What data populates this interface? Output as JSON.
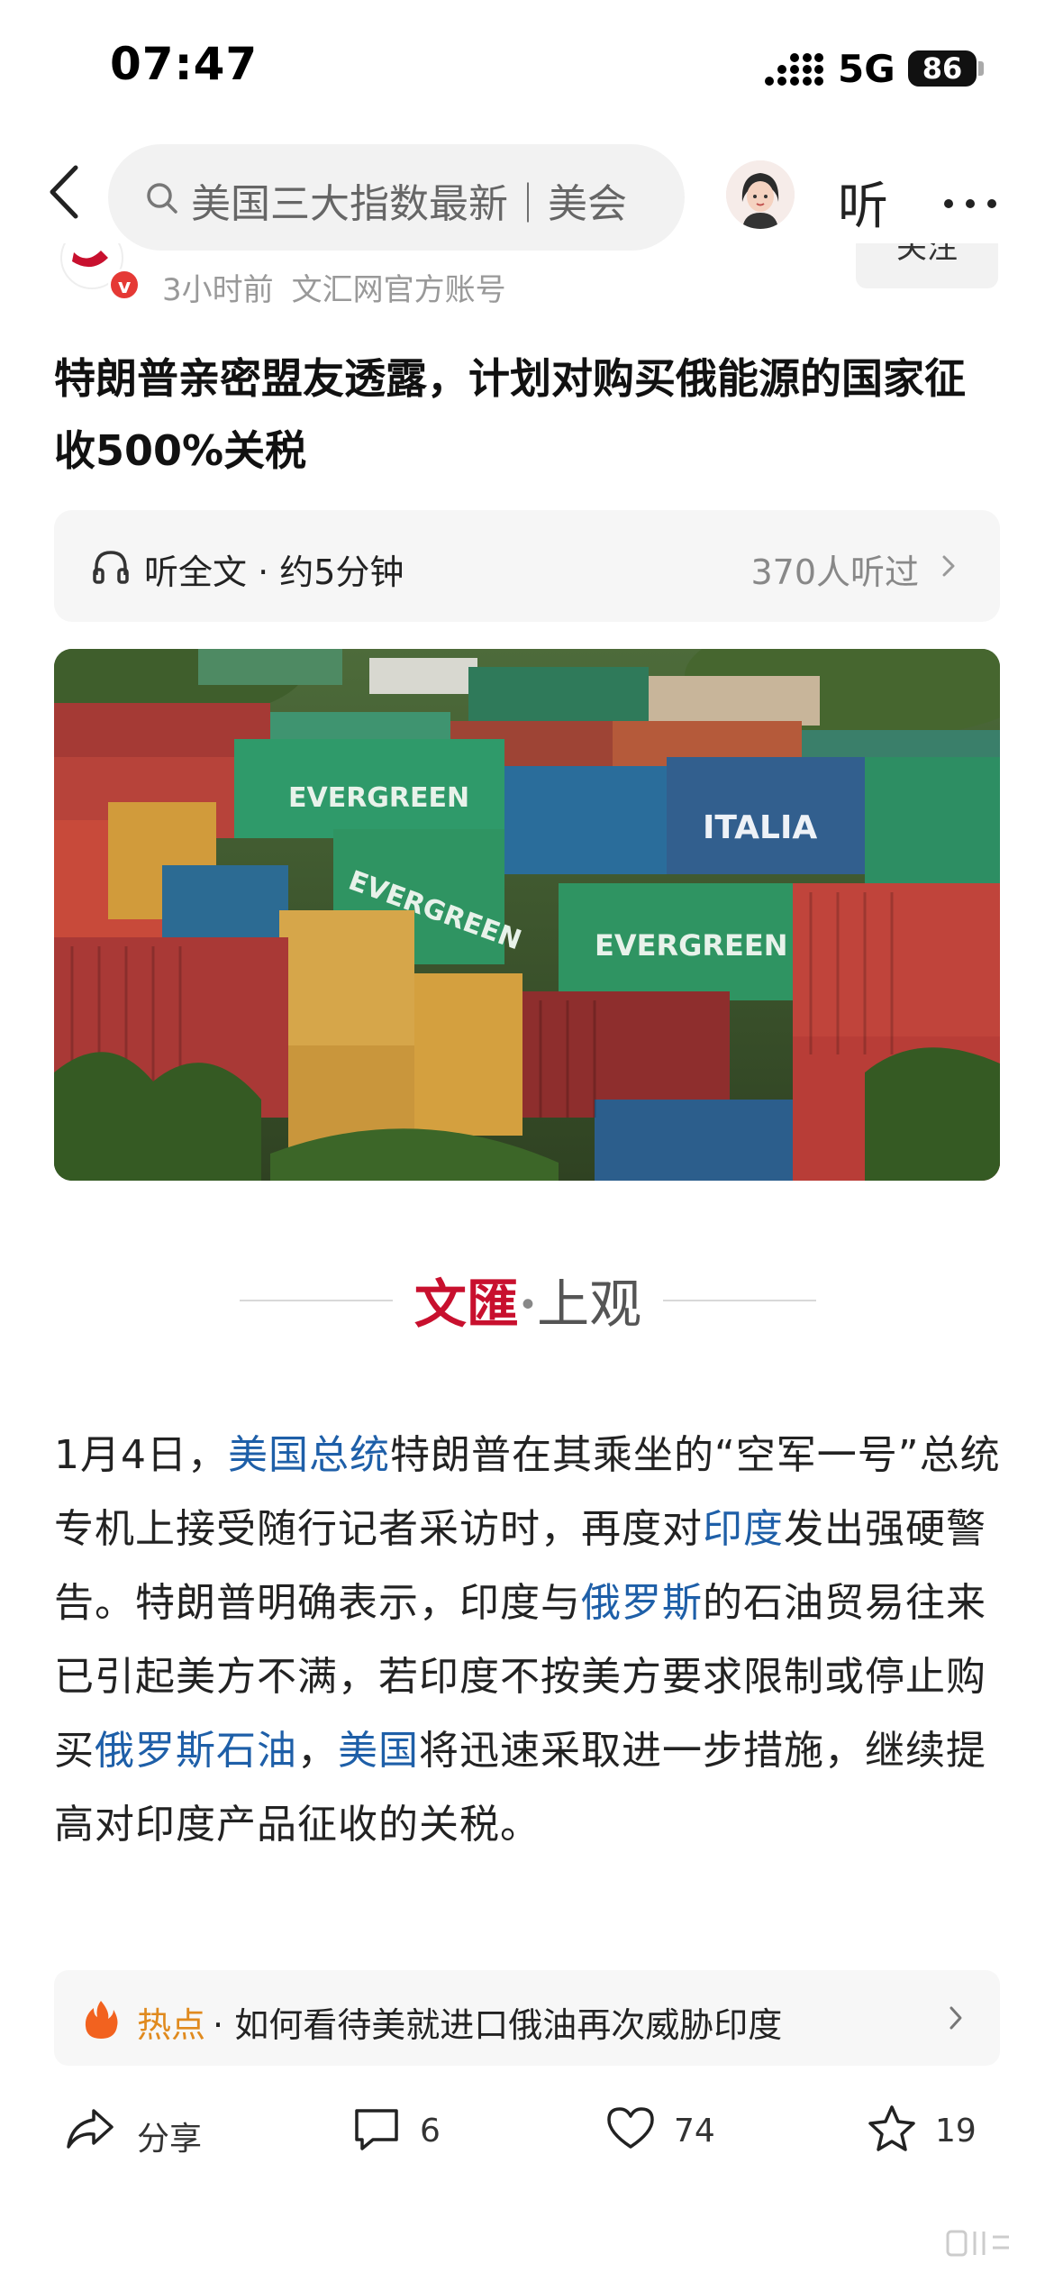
{
  "status_bar": {
    "time": "07:47",
    "network": "5G",
    "battery": "86"
  },
  "nav": {
    "search_placeholder": "美国三大指数最新｜美会",
    "listen_label": "听"
  },
  "author": {
    "meta_time": "3小时前",
    "meta_source": "文汇网官方账号",
    "verified_mark": "v",
    "follow_label": "关注"
  },
  "article": {
    "title": "特朗普亲密盟友透露，计划对购买俄能源的国家征收500%关税",
    "listen": {
      "label": "听全文 · 约5分钟",
      "count": "370人听过"
    },
    "source_logo": {
      "part1": "文匯",
      "dot": "·",
      "part2": "上观"
    },
    "paragraph": [
      {
        "text": "1月4日，",
        "link": false
      },
      {
        "text": "美国总统",
        "link": true
      },
      {
        "text": "特朗普在其乘坐的“空军一号”总统专机上接受随行记者采访时，再度对",
        "link": false
      },
      {
        "text": "印度",
        "link": true
      },
      {
        "text": "发出强硬警告。特朗普明确表示，印度与",
        "link": false
      },
      {
        "text": "俄罗斯",
        "link": true
      },
      {
        "text": "的石油贸易往来已引起美方不满，若印度不按美方要求限制或停止购买",
        "link": false
      },
      {
        "text": "俄罗斯石油",
        "link": true
      },
      {
        "text": "，",
        "link": false
      },
      {
        "text": "美国",
        "link": true
      },
      {
        "text": "将迅速采取进一步措施，继续提高对印度产品征收的关税。",
        "link": false
      }
    ]
  },
  "hot_topic": {
    "label": "热点",
    "separator": "·",
    "text": "如何看待美就进口俄油再次威胁印度"
  },
  "actions": {
    "share": "分享",
    "comments": "6",
    "likes": "74",
    "favorites": "19"
  },
  "image": {
    "description_labels": [
      "EVERGREEN",
      "EVERGREEN",
      "EVERGREEN",
      "EVERGREEN",
      "ITALIA",
      "EVERGREEN"
    ]
  }
}
